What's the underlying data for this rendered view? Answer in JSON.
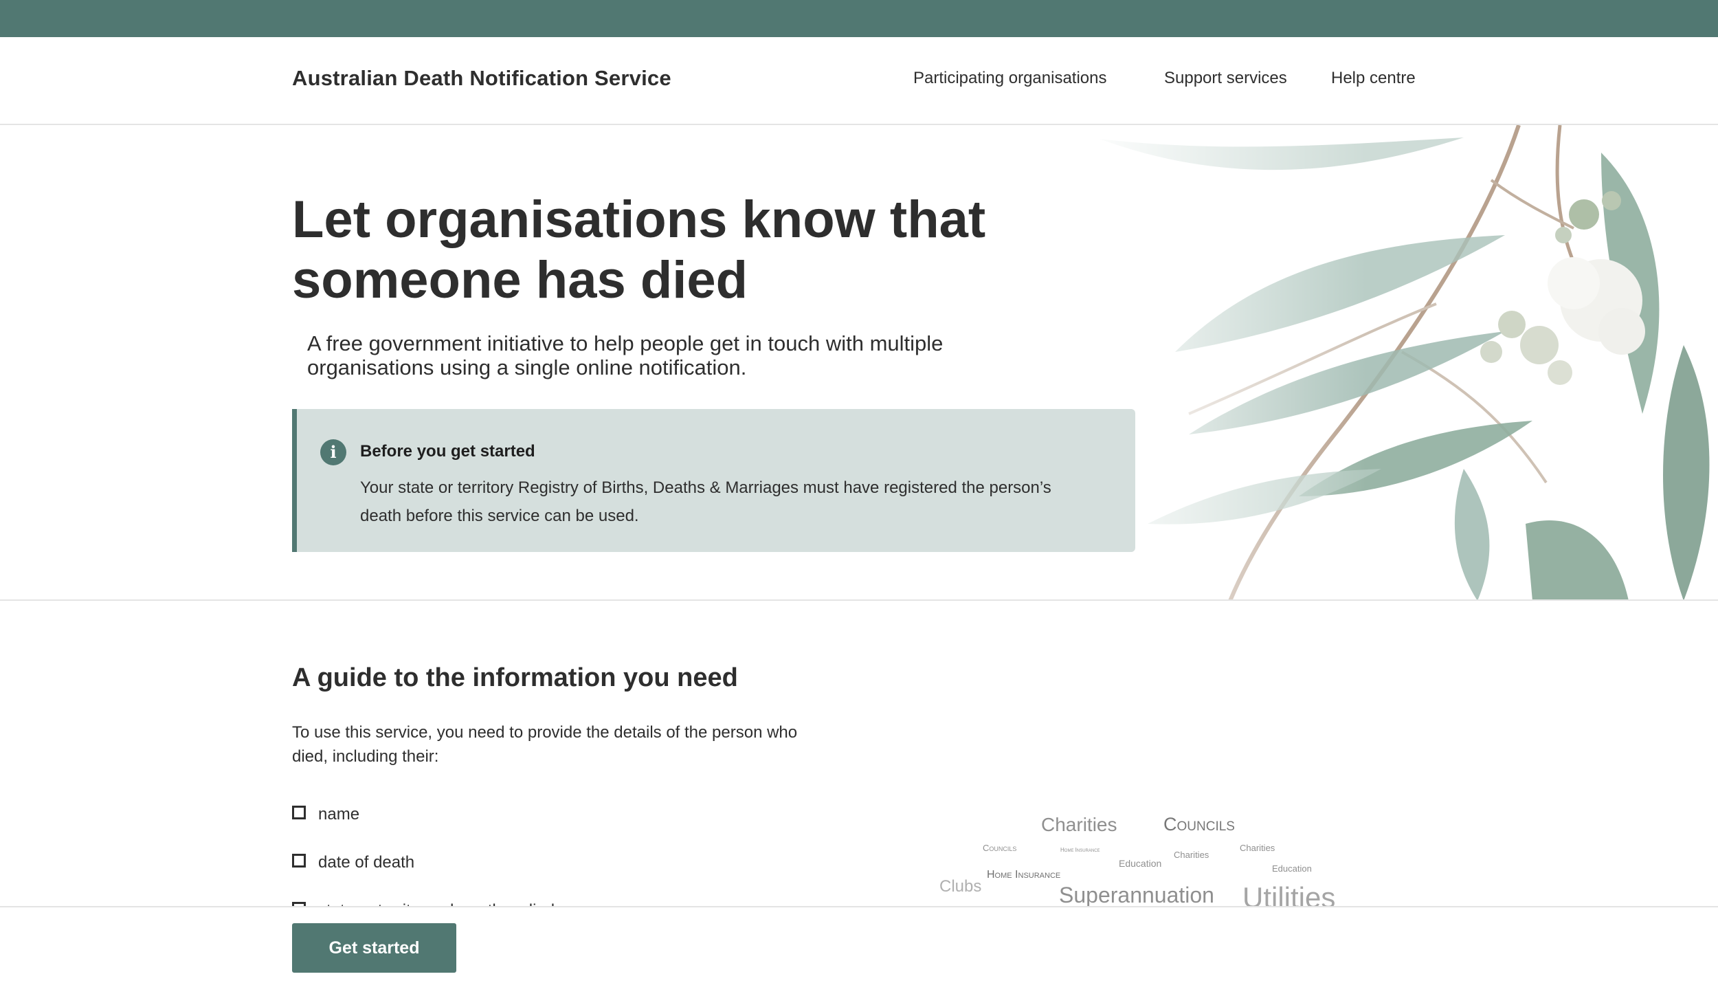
{
  "header": {
    "brand": "Australian Death Notification Service",
    "nav": [
      {
        "label": "Participating organisations"
      },
      {
        "label": "Support services"
      },
      {
        "label": "Help centre"
      }
    ]
  },
  "hero": {
    "title": "Let organisations know that someone has died",
    "subtitle": "A free government initiative to help people get in touch with multiple organisations using a single online notification.",
    "notice": {
      "icon": "info-icon",
      "title": "Before you get started",
      "body": "Your state or territory Registry of Births, Deaths & Marriages must have registered the person’s death before this service can be used."
    }
  },
  "guide": {
    "title": "A guide to the information you need",
    "intro": "To use this service, you need to provide the details of the person who died, including their:",
    "items": [
      "name",
      "date of death",
      "state or territory where they died"
    ]
  },
  "word_cloud": [
    "Charities",
    "Councils",
    "Councils",
    "Home Insurance",
    "Education",
    "Charities",
    "Charities",
    "Education",
    "Home Insurance",
    "Clubs",
    "Superannuation",
    "Utilities"
  ],
  "footer": {
    "cta_label": "Get started"
  },
  "colors": {
    "accent": "#517872",
    "notice_bg": "#d5dfdd",
    "text": "#2e2e2e"
  }
}
